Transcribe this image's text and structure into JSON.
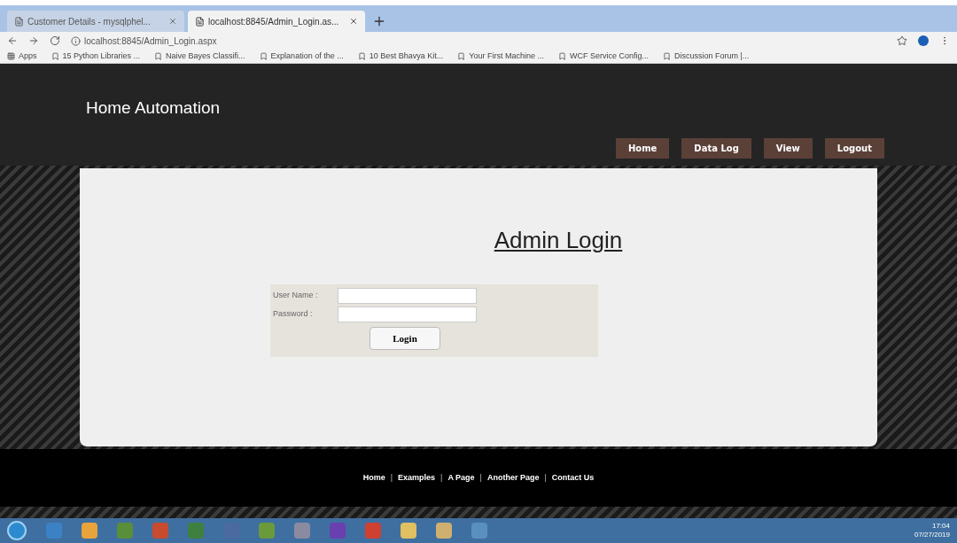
{
  "browser": {
    "tabs": [
      {
        "title": "Customer Details - mysqlphel...",
        "selected": false
      },
      {
        "title": "localhost:8845/Admin_Login.as...",
        "selected": true
      }
    ],
    "url": "localhost:8845/Admin_Login.aspx",
    "bookmarks": [
      "Apps",
      "15 Python Libraries ...",
      "Naive Bayes Classifi...",
      "Explanation of the ...",
      "10 Best Bhavya Kit...",
      "Your First Machine ...",
      "WCF Service Config...",
      "Discussion Forum |..."
    ]
  },
  "site": {
    "title": "Home Automation",
    "nav": [
      {
        "label": "Home"
      },
      {
        "label": "Data Log"
      },
      {
        "label": "View"
      },
      {
        "label": "Logout"
      }
    ],
    "heading": "Admin Login",
    "form": {
      "fields": [
        {
          "label": "User Name :"
        },
        {
          "label": "Password :"
        }
      ],
      "button": "Login"
    },
    "footer_links": [
      {
        "kind": "link",
        "text": "Home"
      },
      {
        "kind": "separator",
        "text": "|"
      },
      {
        "kind": "link",
        "text": "Examples"
      },
      {
        "kind": "separator",
        "text": "|"
      },
      {
        "kind": "link",
        "text": "A Page"
      },
      {
        "kind": "separator",
        "text": "|"
      },
      {
        "kind": "link",
        "text": "Another Page"
      },
      {
        "kind": "separator",
        "text": "|"
      },
      {
        "kind": "link",
        "text": "Contact Us"
      }
    ]
  },
  "taskbar": {
    "time": "17:04",
    "date": "07/27/2019"
  }
}
